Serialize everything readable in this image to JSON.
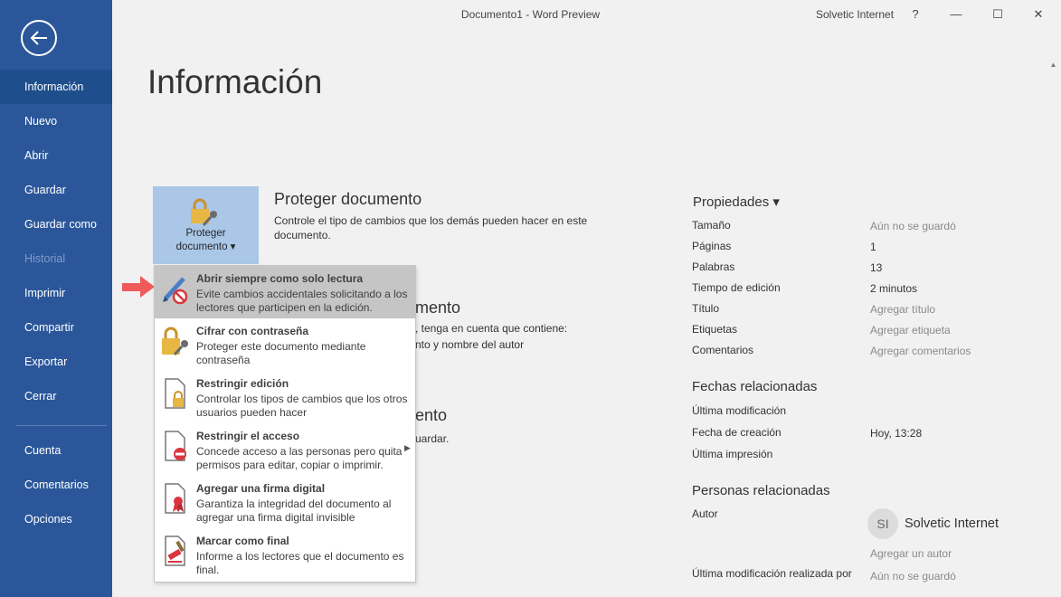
{
  "window": {
    "title": "Documento1  -  Word Preview",
    "account": "Solvetic Internet",
    "help": "?",
    "minimize": "—",
    "maximize": "☐",
    "close": "✕"
  },
  "sidebar": {
    "items": [
      {
        "label": "Información"
      },
      {
        "label": "Nuevo"
      },
      {
        "label": "Abrir"
      },
      {
        "label": "Guardar"
      },
      {
        "label": "Guardar como"
      },
      {
        "label": "Historial"
      },
      {
        "label": "Imprimir"
      },
      {
        "label": "Compartir"
      },
      {
        "label": "Exportar"
      },
      {
        "label": "Cerrar"
      },
      {
        "label": "Cuenta"
      },
      {
        "label": "Comentarios"
      },
      {
        "label": "Opciones"
      }
    ]
  },
  "main": {
    "title": "Información",
    "protect": {
      "button_line1": "Proteger",
      "button_line2": "documento ▾",
      "heading": "Proteger documento",
      "description": "Controle el tipo de cambios que los demás pueden hacer en este documento."
    },
    "inspect": {
      "heading_partial": "mento",
      "line1_partial": ", tenga en cuenta que contiene:",
      "line2_partial": "nto y nombre del autor"
    },
    "manage": {
      "heading_partial": "ento",
      "line1_partial": "uardar."
    }
  },
  "menu": {
    "items": [
      {
        "title": "Abrir siempre como solo lectura",
        "desc": "Evite cambios accidentales solicitando a los lectores que participen en la edición."
      },
      {
        "title": "Cifrar con contraseña",
        "desc": "Proteger este documento mediante contraseña"
      },
      {
        "title": "Restringir edición",
        "desc": "Controlar los tipos de cambios que los otros usuarios pueden hacer"
      },
      {
        "title": "Restringir el acceso",
        "desc": "Concede acceso a las personas pero quita permisos para editar, copiar o imprimir."
      },
      {
        "title": "Agregar una firma digital",
        "desc": "Garantiza la integridad del documento al agregar una firma digital invisible"
      },
      {
        "title": "Marcar como final",
        "desc": "Informe a los lectores que el documento es final."
      }
    ]
  },
  "properties": {
    "heading": "Propiedades ▾",
    "rows": [
      {
        "key": "Tamaño",
        "value": "Aún no se guardó"
      },
      {
        "key": "Páginas",
        "value": "1"
      },
      {
        "key": "Palabras",
        "value": "13"
      },
      {
        "key": "Tiempo de edición",
        "value": "2 minutos"
      },
      {
        "key": "Título",
        "value": "Agregar título"
      },
      {
        "key": "Etiquetas",
        "value": "Agregar etiqueta"
      },
      {
        "key": "Comentarios",
        "value": "Agregar comentarios"
      }
    ],
    "dates": {
      "heading": "Fechas relacionadas",
      "rows": [
        {
          "key": "Última modificación",
          "value": ""
        },
        {
          "key": "Fecha de creación",
          "value": "Hoy, 13:28"
        },
        {
          "key": "Última impresión",
          "value": ""
        }
      ]
    },
    "people": {
      "heading": "Personas relacionadas",
      "author_label": "Autor",
      "author_initials": "SI",
      "author_name": "Solvetic Internet",
      "add_author": "Agregar un autor",
      "last_modified_by_label": "Última modificación realizada por",
      "last_modified_by_value": "Aún no se guardó"
    }
  }
}
